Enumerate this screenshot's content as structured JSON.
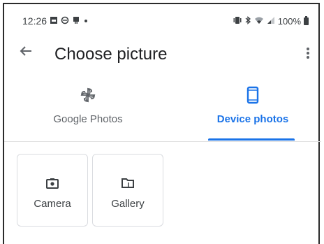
{
  "status_bar": {
    "time": "12:26",
    "battery": "100%",
    "left_icons": [
      "image-notification-icon",
      "circle-notification-icon",
      "vpn-notification-icon",
      "dot-notification-icon"
    ],
    "right_icons": [
      "vibrate-icon",
      "bluetooth-icon",
      "wifi-icon",
      "signal-icon",
      "battery-icon"
    ]
  },
  "toolbar": {
    "title": "Choose picture",
    "back_icon": "arrow-back-icon",
    "more_icon": "more-vert-icon"
  },
  "tabs": [
    {
      "label": "Google Photos",
      "icon": "pinwheel-icon",
      "selected": false
    },
    {
      "label": "Device photos",
      "icon": "smartphone-icon",
      "selected": true
    }
  ],
  "sources": [
    {
      "label": "Camera",
      "icon": "camera-icon"
    },
    {
      "label": "Gallery",
      "icon": "folder-icon"
    }
  ],
  "colors": {
    "accent": "#1a73e8",
    "text_primary": "#202124",
    "text_secondary": "#5f6368",
    "divider": "#e0e0e0"
  }
}
